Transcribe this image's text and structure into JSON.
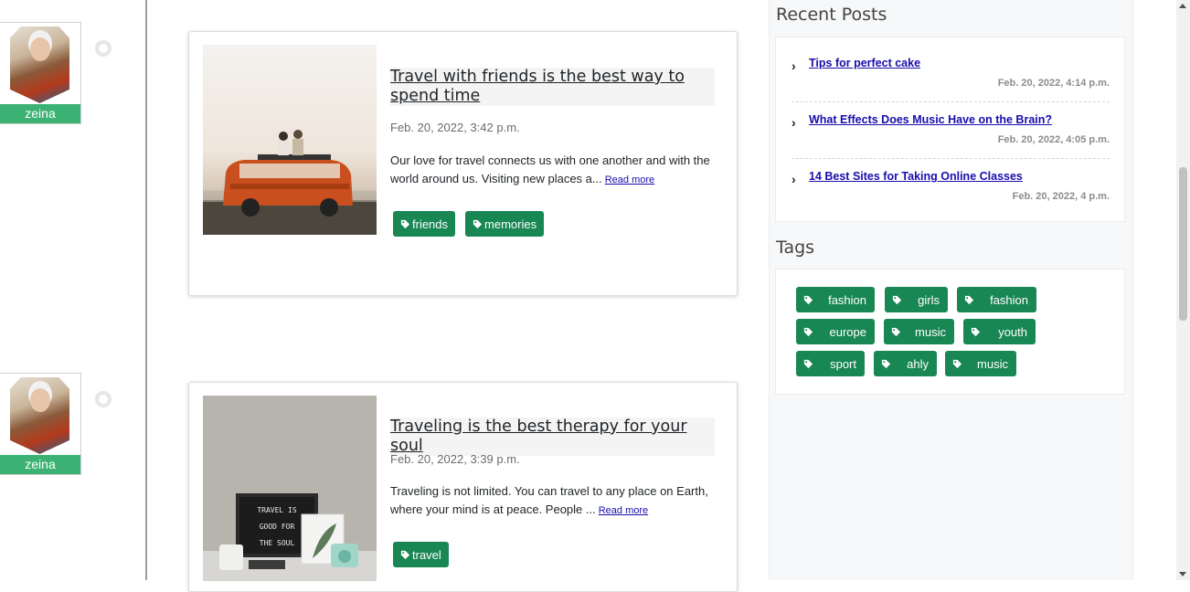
{
  "posts": [
    {
      "author": "zeina",
      "title": "Travel with friends is the best way to spend time",
      "date": "Feb. 20, 2022, 3:42 p.m.",
      "excerpt": "Our love for travel connects us with one another and with the world around us. Visiting new places a...",
      "read_more": "Read more",
      "tags": [
        "friends",
        "memories"
      ]
    },
    {
      "author": "zeina",
      "title": "Traveling is the best therapy for your soul",
      "date": "Feb. 20, 2022, 3:39 p.m.",
      "excerpt": "Traveling is not limited. You can travel to any place on Earth, where your mind is at peace. People ...",
      "read_more": "Read more",
      "tags": [
        "travel"
      ],
      "image_text": [
        "TRAVEL IS",
        "GOOD FOR",
        "THE SOUL"
      ]
    }
  ],
  "sidebar": {
    "recent_heading": "Recent Posts",
    "recent_posts": [
      {
        "title": "Tips for perfect cake",
        "date": "Feb. 20, 2022, 4:14 p.m."
      },
      {
        "title": "What Effects Does Music Have on the Brain?",
        "date": "Feb. 20, 2022, 4:05 p.m."
      },
      {
        "title": "14 Best Sites for Taking Online Classes",
        "date": "Feb. 20, 2022, 4 p.m."
      }
    ],
    "tags_heading": "Tags",
    "tags": [
      "fashion",
      "girls",
      "fashion",
      "europe",
      "music",
      "youth",
      "sport",
      "ahly",
      "music"
    ]
  },
  "colors": {
    "tag_green": "#198754",
    "author_green": "#3bb273",
    "link_blue": "#1a0dab"
  },
  "icons": {
    "tag": "tag-icon",
    "chevron": "chevron-right-icon"
  }
}
